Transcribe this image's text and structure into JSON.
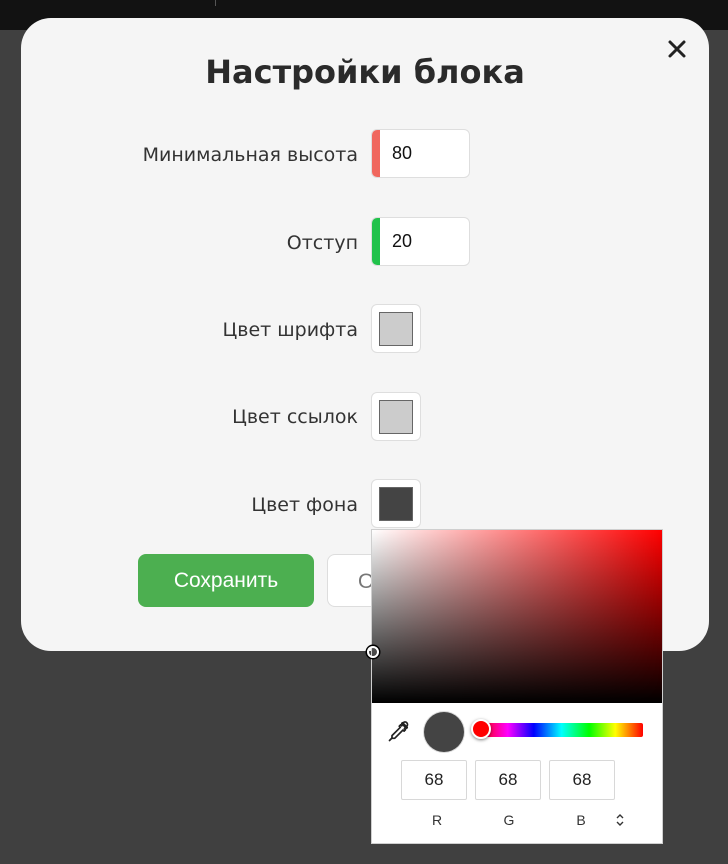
{
  "modal": {
    "title": "Настройки блока",
    "fields": [
      {
        "label": "Минимальная высота",
        "value": "80",
        "accent": "#f0675e"
      },
      {
        "label": "Отступ",
        "value": "20",
        "accent": "#21c24b"
      },
      {
        "label": "Цвет шрифта",
        "color": "#cccccc"
      },
      {
        "label": "Цвет ссылок",
        "color": "#cccccc"
      },
      {
        "label": "Цвет фона",
        "color": "#444444"
      }
    ],
    "save_label": "Сохранить",
    "cancel_label": "О"
  },
  "picker": {
    "hue_color": "#ff0000",
    "preview_color": "#444444",
    "r": "68",
    "g": "68",
    "b": "68",
    "r_label": "R",
    "g_label": "G",
    "b_label": "B"
  },
  "icons": {
    "close": "close-icon",
    "eyedropper": "eyedropper-icon",
    "mode_toggle": "chevron-up-down-icon"
  }
}
